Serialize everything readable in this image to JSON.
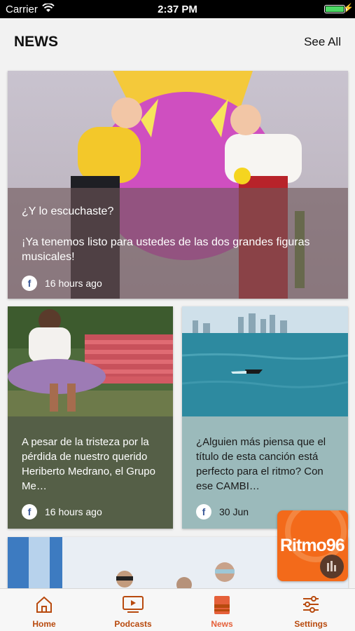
{
  "status": {
    "carrier": "Carrier",
    "time": "2:37 PM"
  },
  "header": {
    "title": "NEWS",
    "see_all": "See All"
  },
  "cards": [
    {
      "headline": "¿Y lo escuchaste?",
      "body": "¡Ya tenemos listo para ustedes de las dos grandes figuras musicales!",
      "source": "f",
      "time": "16 hours ago"
    },
    {
      "body": "A pesar de la tristeza por la pérdida de nuestro querido Heriberto Medrano, el Grupo Me…",
      "source": "f",
      "time": "16 hours ago"
    },
    {
      "body": "¿Alguien más piensa que el título de esta canción está perfecto para el ritmo? Con ese CAMBI…",
      "source": "f",
      "time": "30 Jun"
    }
  ],
  "player": {
    "logo_text": "Ritmo96"
  },
  "tabs": [
    {
      "label": "Home",
      "icon": "home-icon"
    },
    {
      "label": "Podcasts",
      "icon": "video-icon"
    },
    {
      "label": "News",
      "icon": "news-icon",
      "active": true
    },
    {
      "label": "Settings",
      "icon": "sliders-icon"
    }
  ],
  "colors": {
    "accent": "#b84a0e",
    "logo": "#f36a1a"
  }
}
